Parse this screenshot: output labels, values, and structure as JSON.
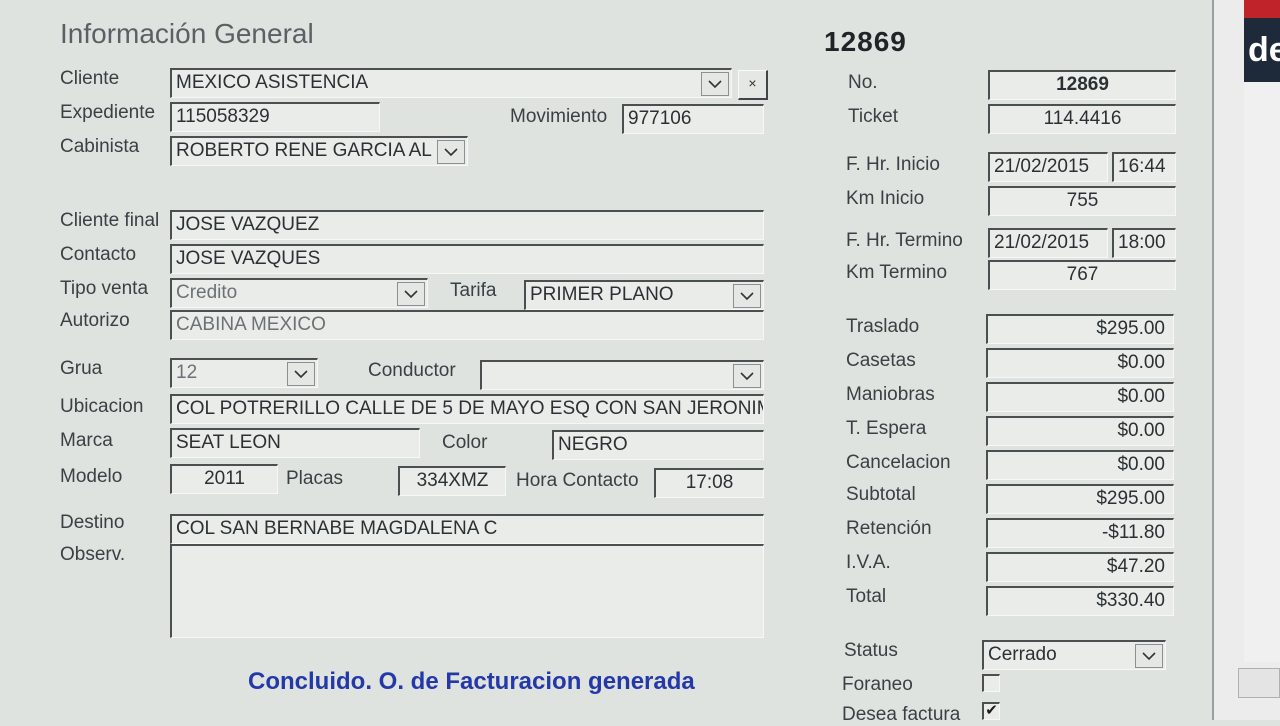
{
  "header": {
    "title": "Información General",
    "record_number": "12869"
  },
  "left": {
    "cliente": {
      "label": "Cliente",
      "value": "MEXICO ASISTENCIA",
      "clear_button": "×"
    },
    "expediente": {
      "label": "Expediente",
      "value": "115058329"
    },
    "movimiento": {
      "label": "Movimiento",
      "value": "977106"
    },
    "cabinista": {
      "label": "Cabinista",
      "value": "ROBERTO RENE GARCIA AL"
    },
    "cliente_final": {
      "label": "Cliente final",
      "value": "JOSE VAZQUEZ"
    },
    "contacto": {
      "label": "Contacto",
      "value": "JOSE VAZQUES"
    },
    "tipo_venta": {
      "label": "Tipo venta",
      "value": "Credito"
    },
    "tarifa": {
      "label": "Tarifa",
      "value": "PRIMER PLANO"
    },
    "autorizo": {
      "label": "Autorizo",
      "value": "CABINA MEXICO"
    },
    "grua": {
      "label": "Grua",
      "value": "12"
    },
    "conductor": {
      "label": "Conductor",
      "value": ""
    },
    "ubicacion": {
      "label": "Ubicacion",
      "value": "COL POTRERILLO CALLE DE 5 DE MAYO ESQ CON SAN JERONIM"
    },
    "marca": {
      "label": "Marca",
      "value": "SEAT LEON"
    },
    "color": {
      "label": "Color",
      "value": "NEGRO"
    },
    "modelo": {
      "label": "Modelo",
      "value": "2011"
    },
    "placas": {
      "label": "Placas",
      "value": "334XMZ"
    },
    "hora_contacto": {
      "label": "Hora Contacto",
      "value": "17:08"
    },
    "destino": {
      "label": "Destino",
      "value": "COL SAN BERNABE MAGDALENA C"
    },
    "observ": {
      "label": "Observ.",
      "value": ""
    },
    "status_message": "Concluido. O. de Facturacion generada"
  },
  "right": {
    "no": {
      "label": "No.",
      "value": "12869"
    },
    "ticket": {
      "label": "Ticket",
      "value": "114.4416"
    },
    "inicio": {
      "label": "F. Hr. Inicio",
      "date": "21/02/2015",
      "time": "16:44"
    },
    "km_inicio": {
      "label": "Km Inicio",
      "value": "755"
    },
    "termino": {
      "label": "F. Hr. Termino",
      "date": "21/02/2015",
      "time": "18:00"
    },
    "km_termino": {
      "label": "Km Termino",
      "value": "767"
    },
    "traslado": {
      "label": "Traslado",
      "value": "$295.00"
    },
    "casetas": {
      "label": "Casetas",
      "value": "$0.00"
    },
    "maniobras": {
      "label": "Maniobras",
      "value": "$0.00"
    },
    "t_espera": {
      "label": "T. Espera",
      "value": "$0.00"
    },
    "cancelacion": {
      "label": "Cancelacion",
      "value": "$0.00"
    },
    "subtotal": {
      "label": "Subtotal",
      "value": "$295.00"
    },
    "retencion": {
      "label": "Retención",
      "value": "-$11.80"
    },
    "iva": {
      "label": "I.V.A.",
      "value": "$47.20"
    },
    "total": {
      "label": "Total",
      "value": "$330.40"
    },
    "status": {
      "label": "Status",
      "value": "Cerrado"
    },
    "foraneo": {
      "label": "Foraneo",
      "checked": false
    },
    "desea_factura": {
      "label": "Desea factura",
      "checked": true,
      "check_glyph": "✔"
    }
  },
  "side_window": {
    "fragment": "de"
  }
}
